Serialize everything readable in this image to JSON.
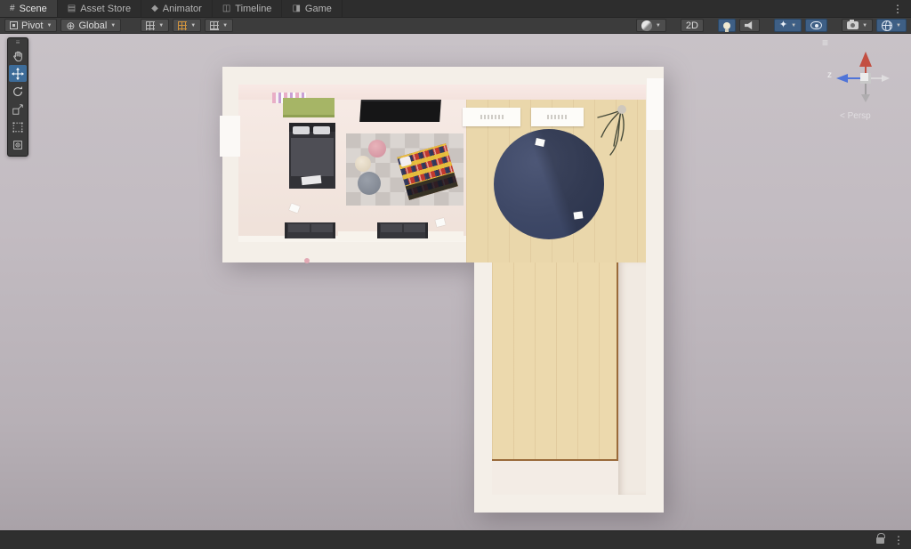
{
  "tabs": [
    {
      "label": "Scene",
      "active": true
    },
    {
      "label": "Asset Store",
      "active": false
    },
    {
      "label": "Animator",
      "active": false
    },
    {
      "label": "Timeline",
      "active": false
    },
    {
      "label": "Game",
      "active": false
    }
  ],
  "toolbar": {
    "pivot_label": "Pivot",
    "global_label": "Global",
    "mode_2d": "2D"
  },
  "glyphs": {
    "scene_tab": "#",
    "asset_store_tab": "▤",
    "animator_tab": "◆",
    "timeline_tab": "◫",
    "game_tab": "◨",
    "kebab": "⋮",
    "hamburger": "≡",
    "dropdown": "▼",
    "global_icon": "⊕",
    "effects_icon": "✦"
  },
  "scene_view": {
    "gizmo": {
      "z_label": "z",
      "projection_label": "< Persp"
    },
    "objects": [
      "bookshelf",
      "books",
      "bed",
      "tv",
      "wall-frame",
      "wall-frame",
      "plant",
      "checkered-rug",
      "pouf-pink",
      "pouf-cream",
      "pouf-gray",
      "plaid-lounger",
      "round-navy-rug",
      "paper",
      "sofa",
      "sofa",
      "ledge"
    ]
  },
  "colors": {
    "selection_blue": "#3d6c99",
    "toggle_blue": "#3e5f85",
    "wall_cream": "#f4efe8",
    "floor_pale": "#f3e7e0",
    "floor_wood": "#ead7ab",
    "round_rug_navy": "#3e4866",
    "snap_grid_orange": "#d2943e",
    "axis_red": "#c34f41",
    "axis_blue": "#4f74d8"
  }
}
